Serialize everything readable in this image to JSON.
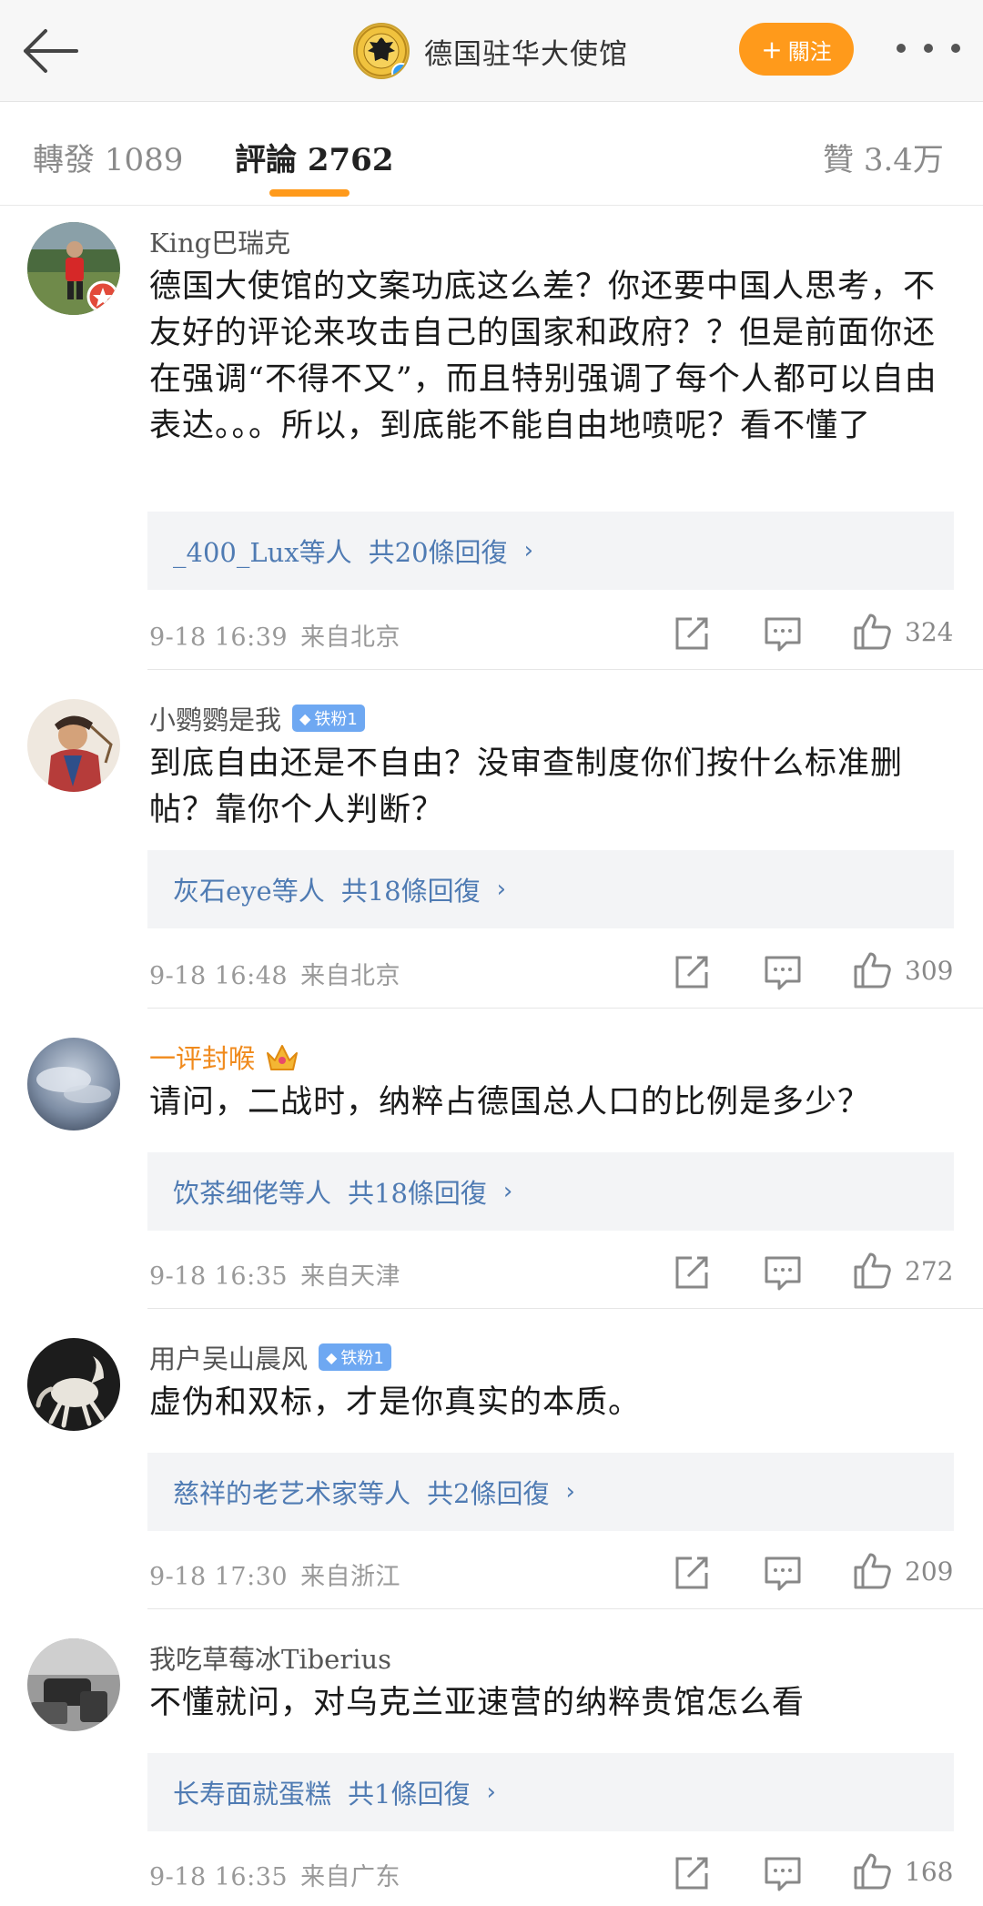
{
  "header": {
    "title": "德国驻华大使馆",
    "follow_label": "關注",
    "follow_plus": "+",
    "verified_mark": "✓"
  },
  "tabs": {
    "reposts_label": "轉發",
    "reposts_count": "1089",
    "comments_label": "評論",
    "comments_count": "2762",
    "likes_label": "贊",
    "likes_count": "3.4万"
  },
  "comments": [
    {
      "user": "King巴瑞克",
      "badge": "",
      "text": "德国大使馆的文案功底这么差？你还要中国人思考，不友好的评论来攻击自己的国家和政府？？但是前面你还在强调“不得不又”，而且特别强调了每个人都可以自由表达。。。所以，到底能不能自由地喷呢？看不懂了",
      "reply_users": "_400_Lux等人",
      "reply_count": "共20條回復",
      "reply_chevron": "›",
      "time": "9-18 16:39",
      "source": "来自北京",
      "likes": "324"
    },
    {
      "user": "小鹦鹦是我",
      "badge": "铁粉1",
      "text": "到底自由还是不自由？没审查制度你们按什么标准删帖？靠你个人判断？",
      "reply_users": "灰石eye等人",
      "reply_count": "共18條回復",
      "reply_chevron": "›",
      "time": "9-18 16:48",
      "source": "来自北京",
      "likes": "309"
    },
    {
      "user": "一评封喉",
      "badge": "",
      "text": "请问，二战时，纳粹占德国总人口的比例是多少？",
      "reply_users": "饮茶细佬等人",
      "reply_count": "共18條回復",
      "reply_chevron": "›",
      "time": "9-18 16:35",
      "source": "来自天津",
      "likes": "272"
    },
    {
      "user": "用户吴山晨风",
      "badge": "铁粉1",
      "text": "虚伪和双标，才是你真实的本质。",
      "reply_users": "慈祥的老艺术家等人",
      "reply_count": "共2條回復",
      "reply_chevron": "›",
      "time": "9-18 17:30",
      "source": "来自浙江",
      "likes": "209"
    },
    {
      "user": "我吃草莓冰Tiberius",
      "badge": "",
      "text": "不懂就问，对乌克兰亚速营的纳粹贵馆怎么看",
      "reply_users": "长寿面就蛋糕",
      "reply_count": "共1條回復",
      "reply_chevron": "›",
      "time": "9-18 16:35",
      "source": "来自广东",
      "likes": "168"
    }
  ],
  "colors": {
    "accent": "#ff9a1b",
    "link": "#4f7bb3",
    "fan_badge": "#6ea8f2"
  },
  "icons": [
    "back-arrow-icon",
    "embassy-eagle-icon",
    "verified-icon",
    "more-dots-icon",
    "repost-icon",
    "comment-icon",
    "like-icon",
    "crown-icon",
    "diamond-icon"
  ]
}
